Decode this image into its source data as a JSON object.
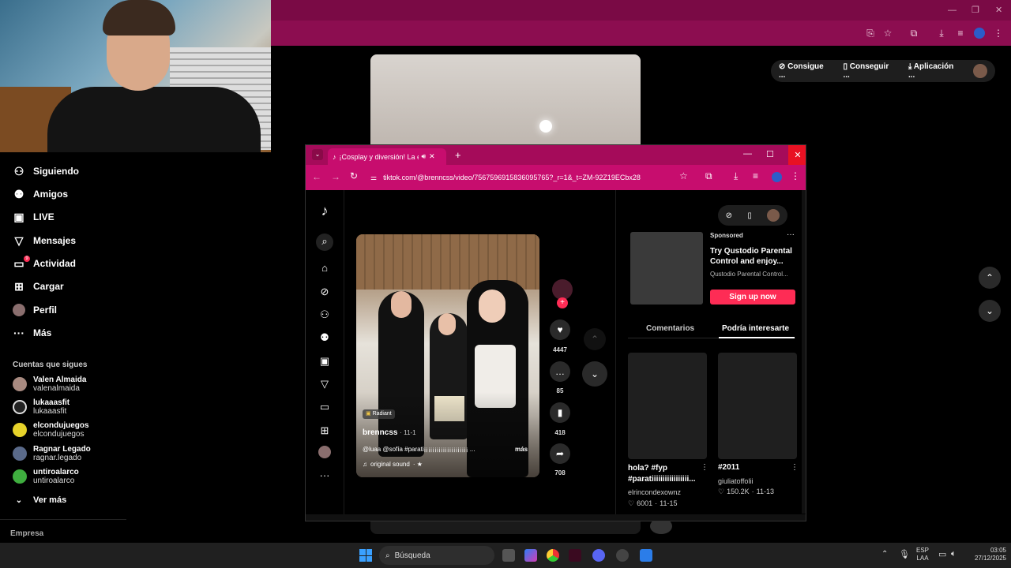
{
  "background_browser": {
    "extensions": {
      "ext1_label": "Consigue ...",
      "ext2_label": "Conseguir ...",
      "ext3_label": "Aplicación ..."
    }
  },
  "left_nav": {
    "items": [
      {
        "label": "Siguiendo",
        "icon": "following-icon"
      },
      {
        "label": "Amigos",
        "icon": "friends-icon"
      },
      {
        "label": "LIVE",
        "icon": "live-icon"
      },
      {
        "label": "Mensajes",
        "icon": "messages-icon"
      },
      {
        "label": "Actividad",
        "icon": "activity-icon",
        "badge": "9"
      },
      {
        "label": "Cargar",
        "icon": "upload-icon"
      },
      {
        "label": "Perfil",
        "icon": "profile-icon"
      },
      {
        "label": "Más",
        "icon": "more-icon"
      }
    ],
    "following_title": "Cuentas que sigues",
    "following": [
      {
        "name": "Valen Almaida",
        "handle": "valenalmaida"
      },
      {
        "name": "lukaaasfit",
        "handle": "lukaaasfit"
      },
      {
        "name": "elcondujuegos",
        "handle": "elcondujuegos"
      },
      {
        "name": "Ragnar Legado",
        "handle": "ragnar.legado"
      },
      {
        "name": "untiroalarco",
        "handle": "untiroalarco"
      }
    ],
    "see_more": "Ver más",
    "footer": "Empresa"
  },
  "foreground_window": {
    "tab_title": "¡Cosplay y diversión! La ese",
    "url": "tiktok.com/@brenncss/video/7567596915836095765?_r=1&_t=ZM-92Z19ECbx28",
    "video": {
      "badge": "Radiant",
      "author": "brenncss",
      "date": "11-1",
      "caption": "@luaa @sofía #parati¡¡¡¡¡¡¡¡¡¡¡¡¡¡¡¡¡¡¡¡¡ ...",
      "more": "más",
      "sound": "original sound",
      "sound_suffix": "· ★"
    },
    "actions": {
      "likes": "4447",
      "comments": "85",
      "saves": "418",
      "shares": "708"
    },
    "ad": {
      "sponsored": "Sponsored",
      "title": "Try Qustodio Parental Control and enjoy...",
      "subtitle": "Qustodio Parental Control...",
      "cta": "Sign up now"
    },
    "tabs": {
      "comments": "Comentarios",
      "suggested": "Podría interesarte"
    },
    "cards": [
      {
        "title": "hola? #fyp #paratiiiiiiiiiiiiiiiii...",
        "author": "elrincondexownz",
        "likes": "6001",
        "date": "11-15"
      },
      {
        "title": "#2011",
        "author": "giuliatoffolii",
        "likes": "150.2K",
        "date": "11-13"
      }
    ]
  },
  "taskbar": {
    "search_placeholder": "Búsqueda",
    "lang_top": "ESP",
    "lang_bottom": "LAA",
    "time": "03:05",
    "date": "27/12/2025"
  },
  "colors": {
    "bg_browser_toolbar": "#8c0d50",
    "fg_browser_toolbar": "#c70d6e",
    "accent_pink": "#fe2c55"
  }
}
